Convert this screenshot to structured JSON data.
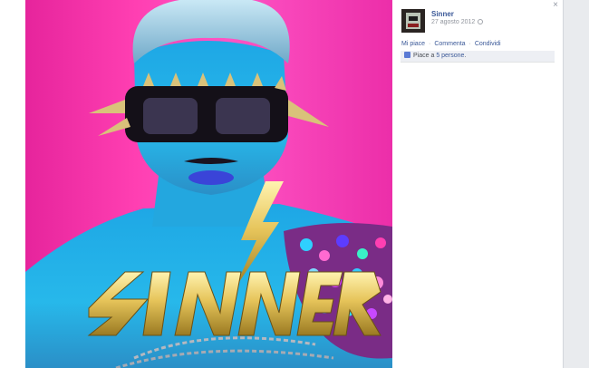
{
  "post": {
    "author": "Sinner",
    "date": "27 agosto 2012",
    "privacy_icon": "globe-icon",
    "close_icon": "×"
  },
  "actions": {
    "like": "Mi piace",
    "comment": "Commenta",
    "share": "Condividi",
    "separator": "·"
  },
  "likes": {
    "prefix": "Piace a",
    "people": "5 persone",
    "suffix": "."
  },
  "photo": {
    "logo_text": "SINNER",
    "colors": {
      "background": "#ff3fb2",
      "skin": "#2fb6e8",
      "logo_gold": "#e2bf52"
    }
  }
}
